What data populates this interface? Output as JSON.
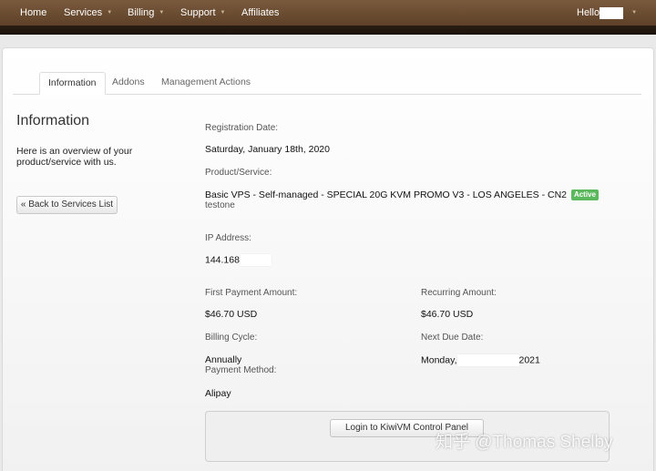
{
  "nav": {
    "home": "Home",
    "services": "Services",
    "billing": "Billing",
    "support": "Support",
    "affiliates": "Affiliates",
    "hello": "Hello",
    "caret": "▼"
  },
  "tabs": [
    {
      "label": "Information",
      "active": true
    },
    {
      "label": "Addons",
      "active": false
    },
    {
      "label": "Management Actions",
      "active": false
    }
  ],
  "left": {
    "title": "Information",
    "description": "Here is an overview of your product/service with us.",
    "back_button": "« Back to Services List"
  },
  "details": {
    "registration_date_label": "Registration Date:",
    "registration_date": "Saturday, January 18th, 2020",
    "product_label": "Product/Service:",
    "product": "Basic VPS - Self-managed - SPECIAL 20G KVM PROMO V3 - LOS ANGELES - CN2",
    "status": "Active",
    "hostname": "testone",
    "ip_label": "IP Address:",
    "ip_prefix": "144.168",
    "first_payment_label": "First Payment Amount:",
    "first_payment": "$46.70 USD",
    "recurring_label": "Recurring Amount:",
    "recurring": "$46.70 USD",
    "billing_cycle_label": "Billing Cycle:",
    "billing_cycle": "Annually",
    "next_due_label": "Next Due Date:",
    "next_due_prefix": "Monday,",
    "next_due_suffix": "2021",
    "payment_method_label": "Payment Method:",
    "payment_method": "Alipay"
  },
  "control_panel": {
    "button": "Login to KiwiVM Control Panel"
  },
  "watermark": "知乎 @Thomas Shelby",
  "colors": {
    "navbar": "#6b4c32",
    "active_badge": "#5cb85c"
  }
}
